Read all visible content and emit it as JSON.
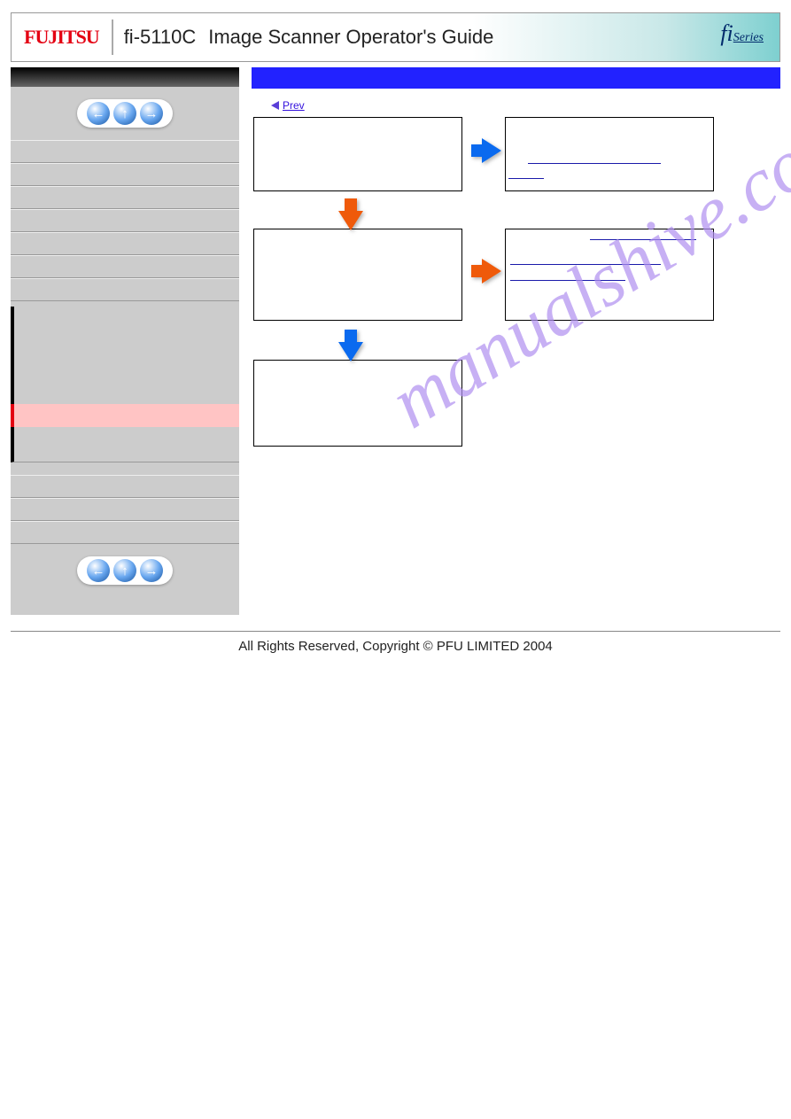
{
  "header": {
    "logo_inner": "JI",
    "model": "fi-5110C",
    "title": "Image Scanner Operator's Guide",
    "series_fi": "fi",
    "series_series": "Series"
  },
  "nav": {
    "prev_glyph": "←",
    "up_glyph": "↑",
    "next_glyph": "→"
  },
  "main": {
    "prev_label": "Prev"
  },
  "watermark": "manualshive.com",
  "footer": "All Rights Reserved,  Copyright © PFU LIMITED 2004"
}
